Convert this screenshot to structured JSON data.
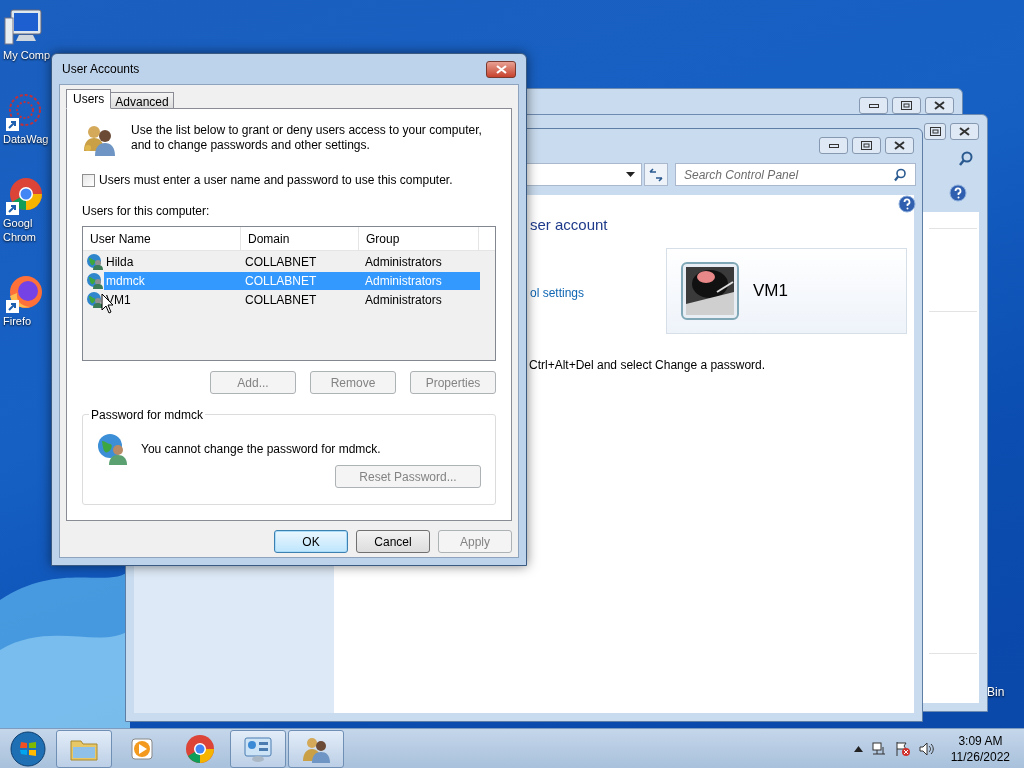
{
  "desktop_icons": [
    {
      "kind": "computer",
      "lines": [
        "My Comp"
      ]
    },
    {
      "kind": "web",
      "lines": [
        "DataWag"
      ]
    },
    {
      "kind": "chrome",
      "lines": [
        "Googl",
        "Chrom"
      ]
    },
    {
      "kind": "firefox",
      "lines": [
        "Firefo"
      ]
    }
  ],
  "recycle_bin": {
    "label": "Bin"
  },
  "control_panel": {
    "search_placeholder": "Search Control Panel",
    "heading": "ser account",
    "link": "ol settings",
    "account_name": "VM1",
    "note": "Ctrl+Alt+Del and select Change a password."
  },
  "dialog": {
    "title": "User Accounts",
    "tabs": [
      {
        "label": "Users",
        "selected": true
      },
      {
        "label": "Advanced",
        "selected": false
      }
    ],
    "intro": "Use the list below to grant or deny users access to your computer, and to change passwords and other settings.",
    "login_checkbox": {
      "label": "Users must enter a user name and password to use this computer.",
      "checked": false
    },
    "list_label": "Users for this computer:",
    "columns": [
      "User Name",
      "Domain",
      "Group"
    ],
    "rows": [
      {
        "name": "Hilda",
        "domain": "COLLABNET",
        "group": "Administrators",
        "selected": false
      },
      {
        "name": "mdmck",
        "domain": "COLLABNET",
        "group": "Administrators",
        "selected": true
      },
      {
        "name": "VM1",
        "domain": "COLLABNET",
        "group": "Administrators",
        "selected": false
      }
    ],
    "list_buttons": [
      {
        "label": "Add...",
        "disabled": true
      },
      {
        "label": "Remove",
        "disabled": true
      },
      {
        "label": "Properties",
        "disabled": true
      }
    ],
    "password_group": {
      "title": "Password for mdmck",
      "message": "You cannot change the password for mdmck.",
      "button": {
        "label": "Reset Password...",
        "disabled": true
      }
    },
    "footer_buttons": [
      {
        "label": "OK",
        "disabled": false,
        "default": true
      },
      {
        "label": "Cancel",
        "disabled": false,
        "default": false
      },
      {
        "label": "Apply",
        "disabled": true,
        "default": false
      }
    ]
  },
  "taskbar": {
    "apps": [
      {
        "kind": "explorer",
        "running": true
      },
      {
        "kind": "media",
        "running": false
      },
      {
        "kind": "chrome",
        "running": false
      },
      {
        "kind": "control_panel",
        "running": true
      },
      {
        "kind": "users",
        "running": true
      }
    ],
    "clock": {
      "time": "3:09 AM",
      "date": "11/26/2022"
    }
  }
}
